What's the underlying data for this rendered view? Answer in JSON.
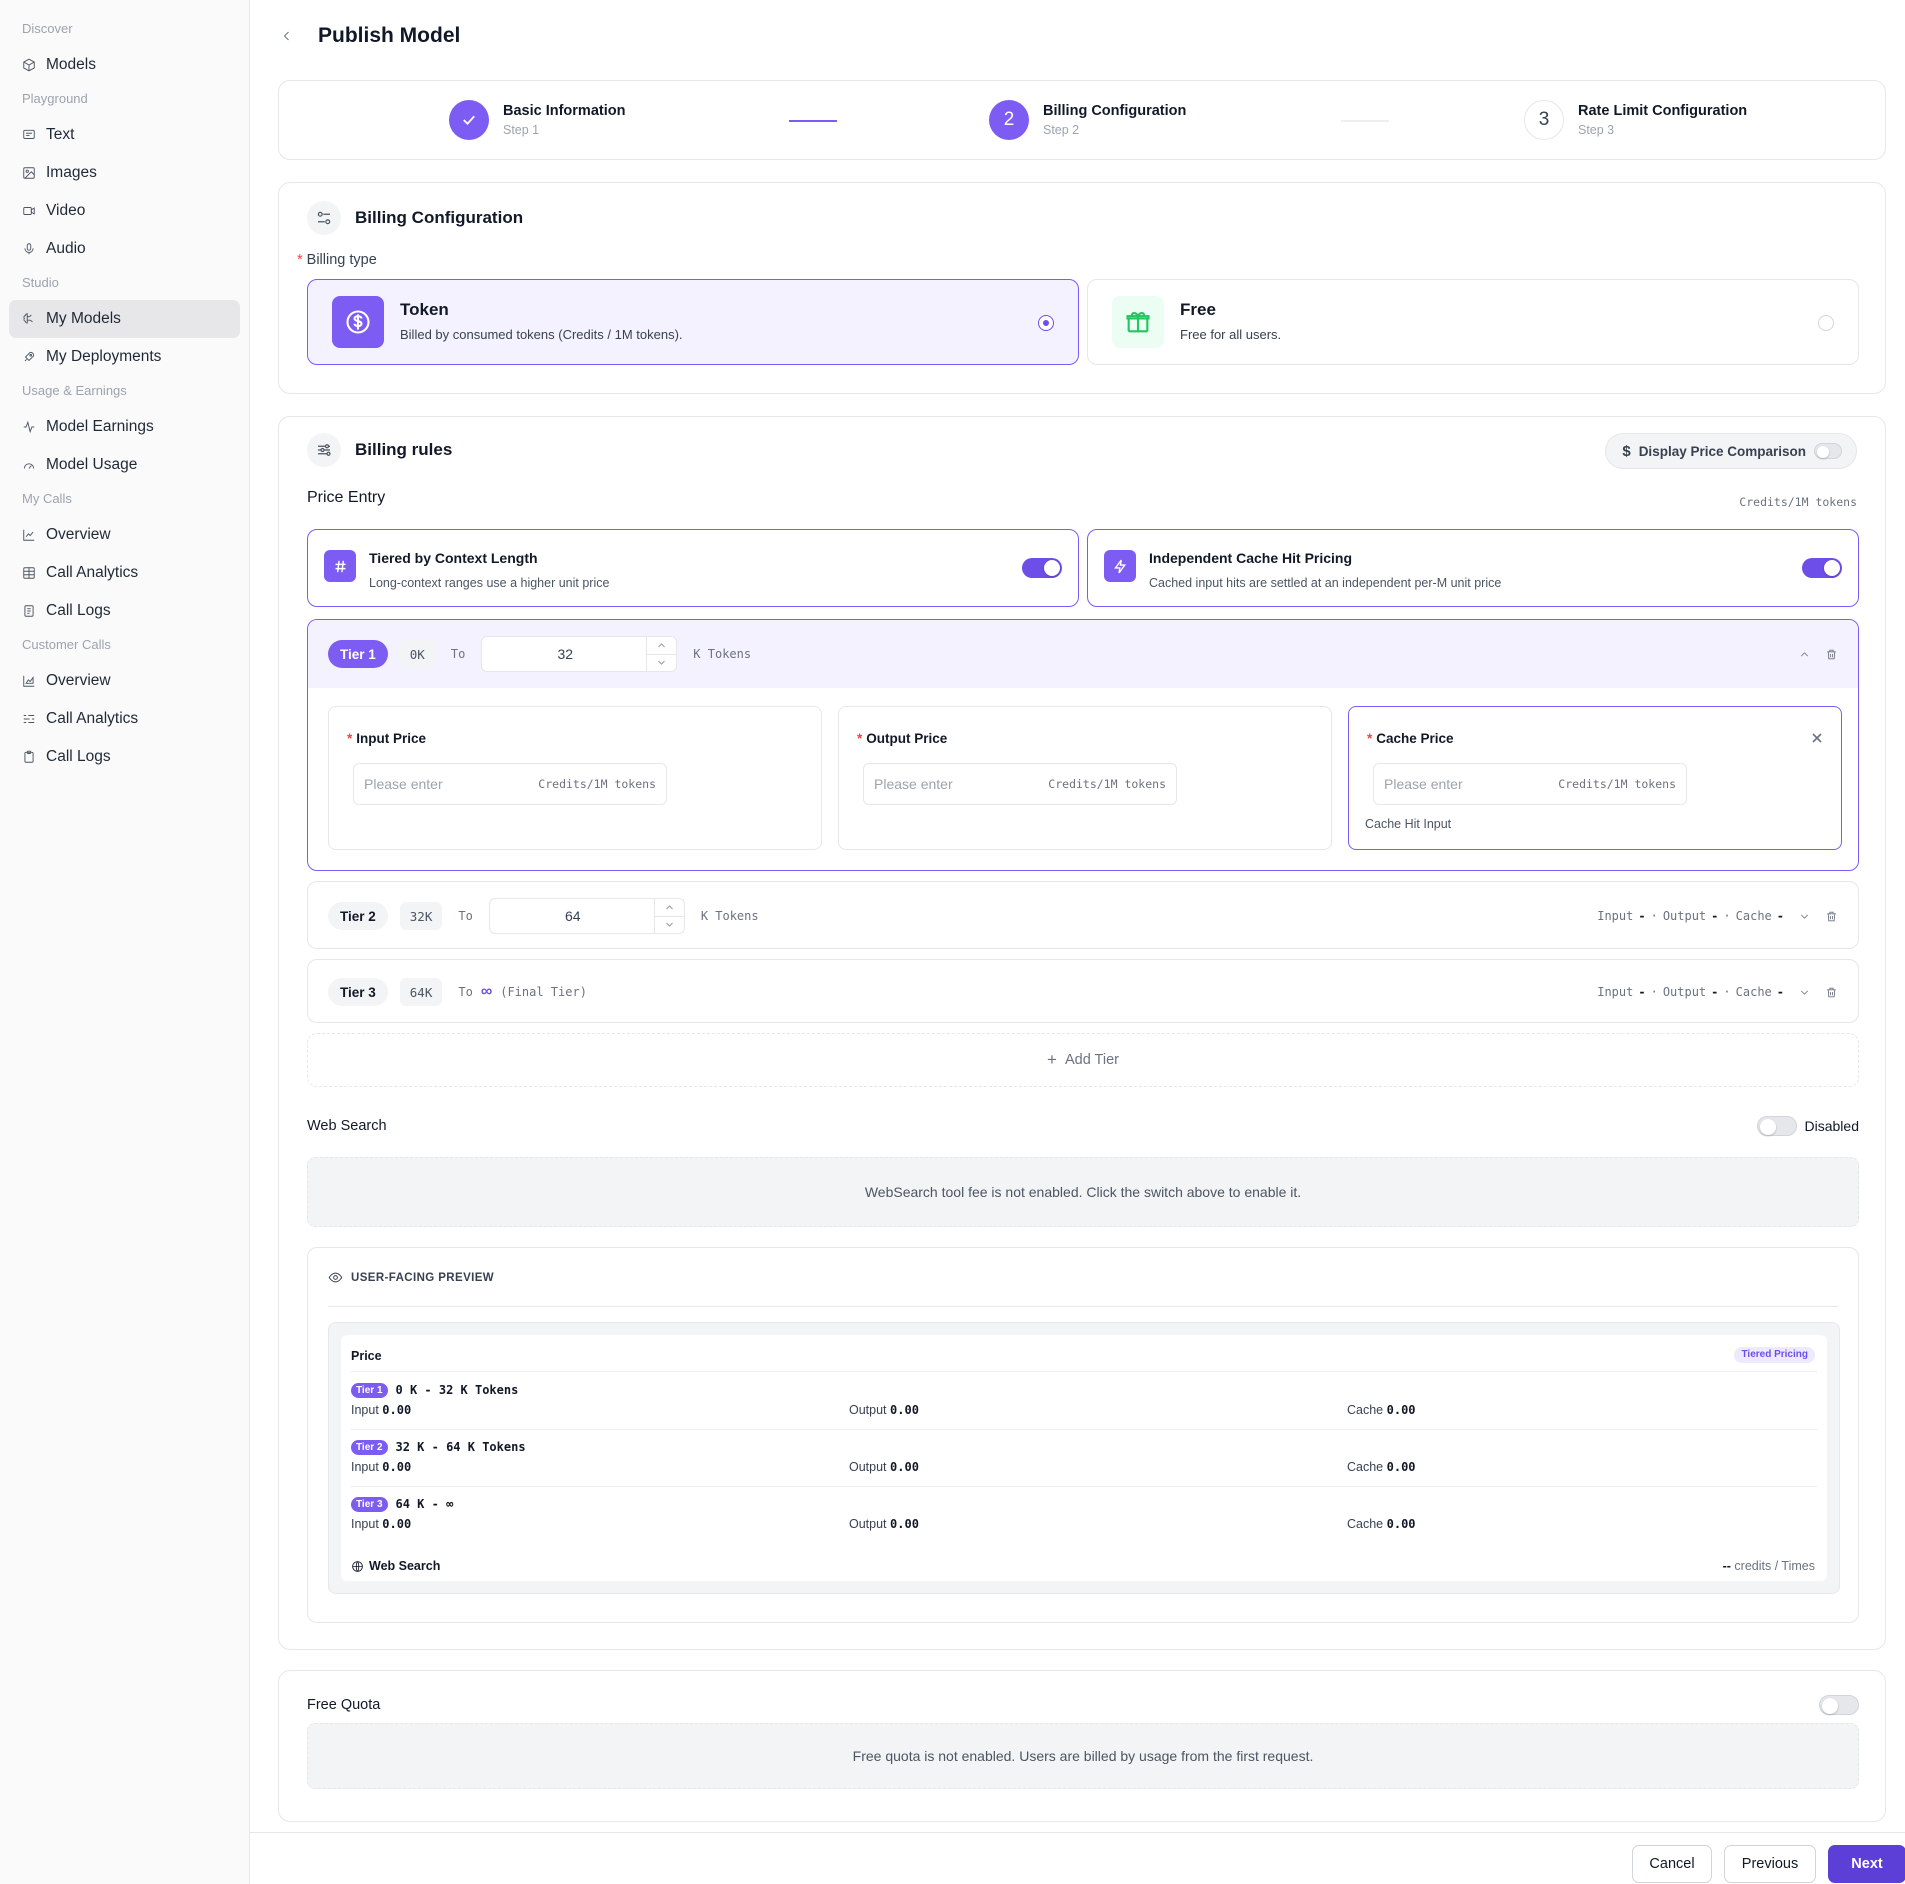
{
  "sidebar": {
    "groups": [
      {
        "label": "Discover",
        "items": [
          {
            "label": "Models",
            "icon": "cube-icon"
          }
        ]
      },
      {
        "label": "Playground",
        "items": [
          {
            "label": "Text",
            "icon": "message-square-icon"
          },
          {
            "label": "Images",
            "icon": "image-icon"
          },
          {
            "label": "Video",
            "icon": "video-icon"
          },
          {
            "label": "Audio",
            "icon": "mic-icon"
          }
        ]
      },
      {
        "label": "Studio",
        "items": [
          {
            "label": "My Models",
            "icon": "brain-icon",
            "active": true
          },
          {
            "label": "My Deployments",
            "icon": "rocket-icon"
          }
        ]
      },
      {
        "label": "Usage & Earnings",
        "items": [
          {
            "label": "Model Earnings",
            "icon": "activity-icon"
          },
          {
            "label": "Model Usage",
            "icon": "gauge-icon"
          }
        ]
      },
      {
        "label": "My Calls",
        "items": [
          {
            "label": "Overview",
            "icon": "line-chart-icon"
          },
          {
            "label": "Call Analytics",
            "icon": "table-icon"
          },
          {
            "label": "Call Logs",
            "icon": "logs-icon"
          }
        ]
      },
      {
        "label": "Customer Calls",
        "items": [
          {
            "label": "Overview",
            "icon": "area-chart-icon"
          },
          {
            "label": "Call Analytics",
            "icon": "list-filter-icon"
          },
          {
            "label": "Call Logs",
            "icon": "clipboard-icon"
          }
        ]
      }
    ]
  },
  "header": {
    "title": "Publish Model"
  },
  "steps": [
    {
      "title": "Basic Information",
      "sub": "Step 1",
      "num": "1",
      "state": "done"
    },
    {
      "title": "Billing Configuration",
      "sub": "Step 2",
      "num": "2",
      "state": "current"
    },
    {
      "title": "Rate Limit Configuration",
      "sub": "Step 3",
      "num": "3",
      "state": "todo"
    }
  ],
  "billing_config": {
    "title": "Billing Configuration",
    "type_label": "Billing type",
    "options": [
      {
        "title": "Token",
        "desc": "Billed by consumed tokens (Credits / 1M tokens).",
        "selected": true
      },
      {
        "title": "Free",
        "desc": "Free for all users.",
        "selected": false
      }
    ]
  },
  "billing_rules": {
    "title": "Billing rules",
    "price_comparison_label": "Display Price Comparison",
    "price_entry_label": "Price Entry",
    "price_entry_unit": "Credits/1M tokens",
    "features": [
      {
        "title": "Tiered by Context Length",
        "desc": "Long-context ranges use a higher unit price",
        "enabled": true
      },
      {
        "title": "Independent Cache Hit Pricing",
        "desc": "Cached input hits are settled at an independent per-M unit price",
        "enabled": true
      }
    ],
    "tiers": [
      {
        "label": "Tier 1",
        "from": "0K",
        "to_label": "To",
        "to_value": "32",
        "unit": "K Tokens"
      },
      {
        "label": "Tier 2",
        "from": "32K",
        "to_label": "To",
        "to_value": "64",
        "unit": "K Tokens"
      },
      {
        "label": "Tier 3",
        "from": "64K",
        "to_label": "To",
        "infinity": "∞",
        "final_label": "(Final Tier)"
      }
    ],
    "tier_summary": {
      "input": "Input",
      "output": "Output",
      "cache": "Cache",
      "dash": "-",
      "dot": "·"
    },
    "price_fields": [
      {
        "label": "Input Price",
        "placeholder": "Please enter",
        "unit": "Credits/1M tokens"
      },
      {
        "label": "Output Price",
        "placeholder": "Please enter",
        "unit": "Credits/1M tokens"
      },
      {
        "label": "Cache Price",
        "placeholder": "Please enter",
        "unit": "Credits/1M tokens",
        "note": "Cache Hit Input"
      }
    ],
    "add_tier_label": "Add Tier",
    "web_search": {
      "label": "Web Search",
      "status": "Disabled",
      "notice": "WebSearch tool fee is not enabled. Click the switch above to enable it."
    },
    "preview": {
      "heading": "USER-FACING PREVIEW",
      "price_label": "Price",
      "tag": "Tiered Pricing",
      "tiers": [
        {
          "badge": "Tier 1",
          "range": "0 K - 32 K Tokens",
          "input": "0.00",
          "output": "0.00",
          "cache": "0.00"
        },
        {
          "badge": "Tier 2",
          "range": "32 K - 64 K Tokens",
          "input": "0.00",
          "output": "0.00",
          "cache": "0.00"
        },
        {
          "badge": "Tier 3",
          "range": "64 K - ∞",
          "input": "0.00",
          "output": "0.00",
          "cache": "0.00"
        }
      ],
      "input_label": "Input",
      "output_label": "Output",
      "cache_label": "Cache",
      "web_search_label": "Web Search",
      "web_search_value": "--",
      "web_search_unit": "credits / Times"
    }
  },
  "free_quota": {
    "label": "Free Quota",
    "enabled": false,
    "notice": "Free quota is not enabled. Users are billed by usage from the first request."
  },
  "footer": {
    "cancel": "Cancel",
    "previous": "Previous",
    "next": "Next"
  },
  "colors": {
    "accent": "#7c5cf3",
    "primary_button": "#5b3fd6",
    "free_icon": "#22c55e",
    "required": "#ef4444"
  }
}
